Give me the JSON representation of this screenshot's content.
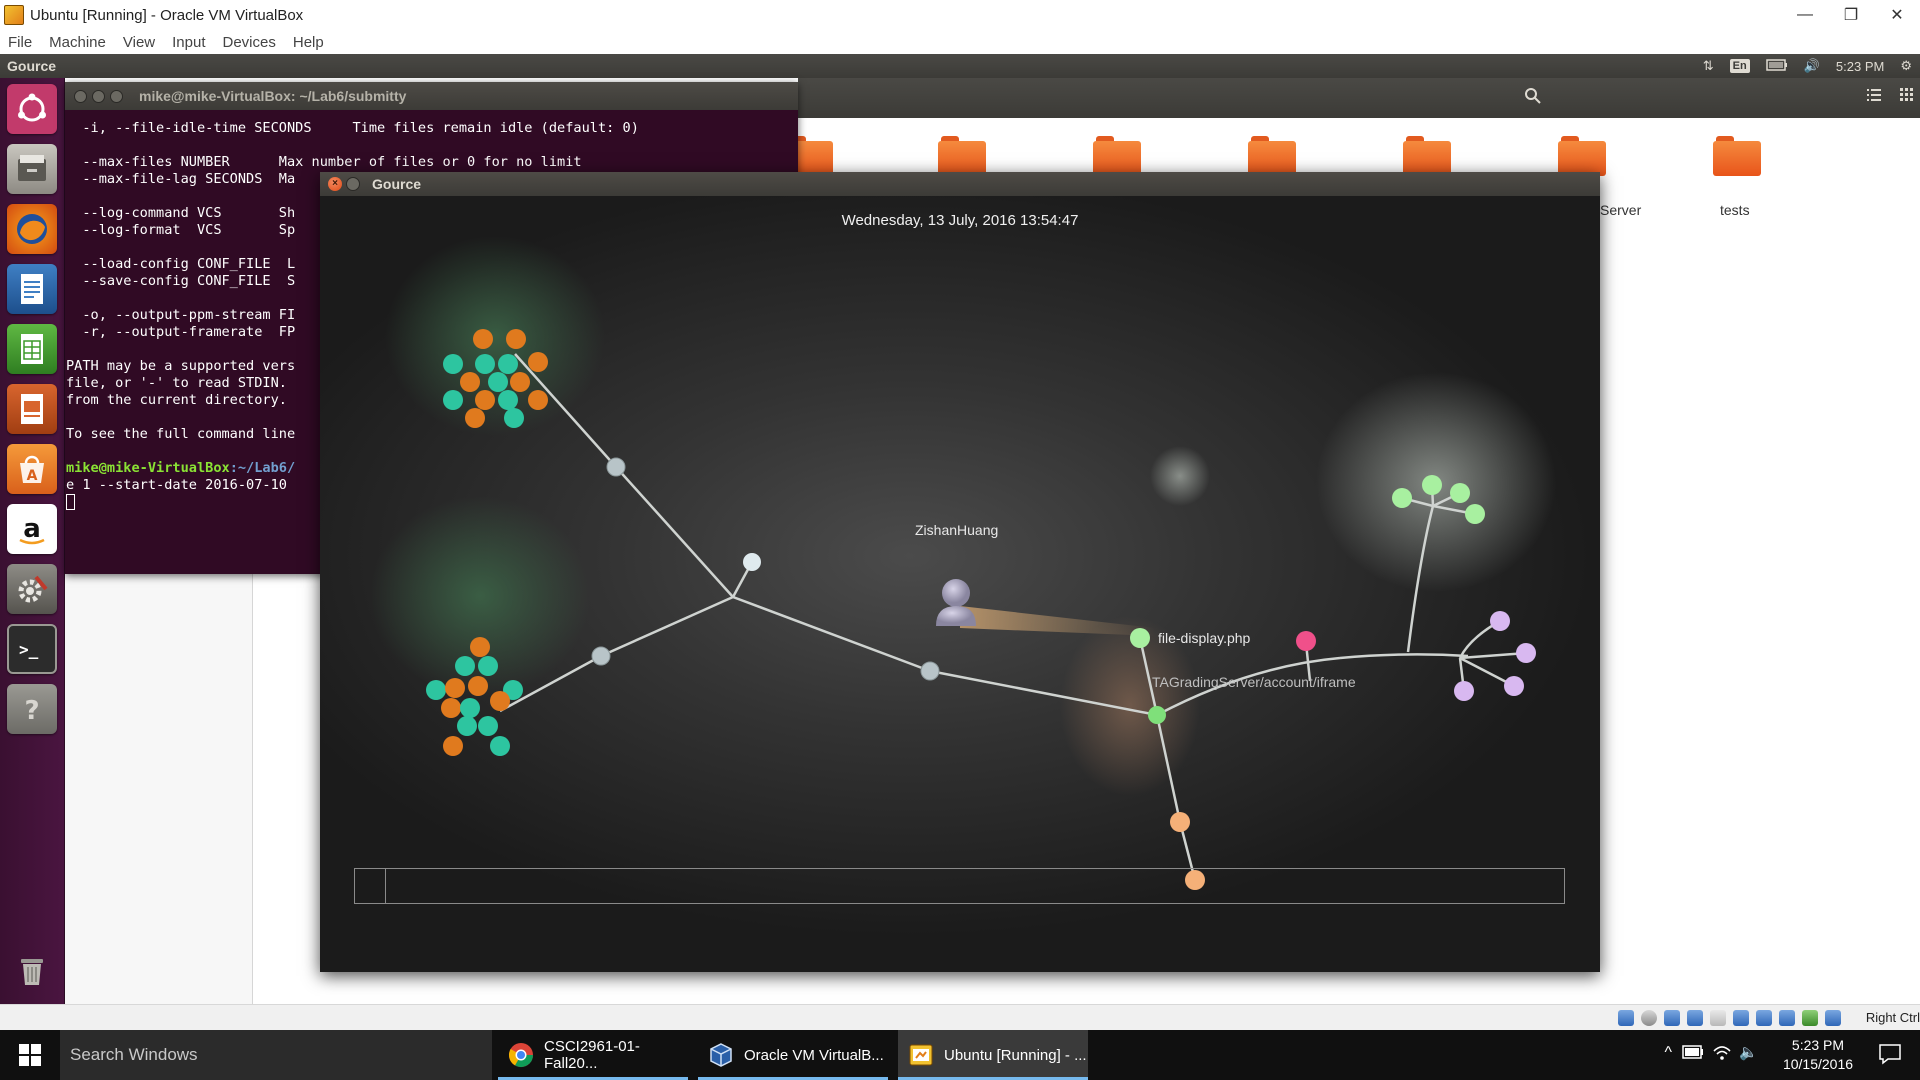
{
  "vbox": {
    "title": "Ubuntu [Running] - Oracle VM VirtualBox",
    "menu": [
      "File",
      "Machine",
      "View",
      "Input",
      "Devices",
      "Help"
    ],
    "window_controls": {
      "minimize": "—",
      "restore": "❐",
      "close": "✕"
    },
    "status_icons": [
      "hard-disk-icon",
      "optical-drive-icon",
      "audio-icon",
      "network-icon",
      "usb-icon",
      "shared-folders-icon",
      "display-icon",
      "video-capture-icon",
      "mouse-integration-icon",
      "keyboard-capture-icon"
    ],
    "host_key": "Right Ctrl"
  },
  "ubuntu_panel": {
    "app_name": "Gource",
    "keyboard_layout": "En",
    "time": "5:23 PM"
  },
  "launcher": {
    "items": [
      "dash-home",
      "files",
      "firefox",
      "libreoffice-writer",
      "libreoffice-calc",
      "libreoffice-impress",
      "ubuntu-software-center",
      "amazon",
      "system-settings",
      "terminal",
      "unknown-app",
      "trash"
    ]
  },
  "files_window": {
    "folders": [
      "",
      "",
      "",
      "",
      "",
      "",
      "tests"
    ],
    "partial_label": "Server"
  },
  "terminal": {
    "title": "mike@mike-VirtualBox: ~/Lab6/submitty",
    "lines": [
      "  -i, --file-idle-time SECONDS     Time files remain idle (default: 0)",
      "",
      "  --max-files NUMBER      Max number of files or 0 for no limit",
      "  --max-file-lag SECONDS  Ma",
      "",
      "  --log-command VCS       Sh",
      "  --log-format  VCS       Sp",
      "",
      "  --load-config CONF_FILE  L",
      "  --save-config CONF_FILE  S",
      "",
      "  -o, --output-ppm-stream FI",
      "  -r, --output-framerate  FP",
      "",
      "PATH may be a supported vers",
      "file, or '-' to read STDIN. ",
      "from the current directory.",
      "",
      "To see the full command line",
      ""
    ],
    "prompt_user": "mike@mike-VirtualBox",
    "prompt_path": ":~/Lab6/",
    "command_tail": "e 1 --start-date 2016-07-10"
  },
  "gource": {
    "window_title": "Gource",
    "date": "Wednesday, 13 July, 2016 13:54:47",
    "user_name": "ZishanHuang",
    "file_label": "file-display.php",
    "dir_label": "TAGradingServer/account/iframe",
    "progress": 0.026,
    "colors": {
      "php_orange": "#e07a1e",
      "php_teal": "#2dc5a0",
      "dir_node": "#b8c4c8",
      "file_green": "#7fe07a",
      "pink": "#f0508a",
      "peach": "#f5b078",
      "lavender": "#c8a8e0"
    }
  },
  "taskbar": {
    "search_placeholder": "Search Windows",
    "tasks": [
      {
        "label": "CSCI2961-01-Fall20...",
        "icon": "chrome-icon"
      },
      {
        "label": "Oracle VM VirtualB...",
        "icon": "virtualbox-icon"
      },
      {
        "label": "Ubuntu [Running] - ...",
        "icon": "virtualbox-vm-icon"
      }
    ],
    "clock_time": "5:23 PM",
    "clock_date": "10/15/2016"
  }
}
